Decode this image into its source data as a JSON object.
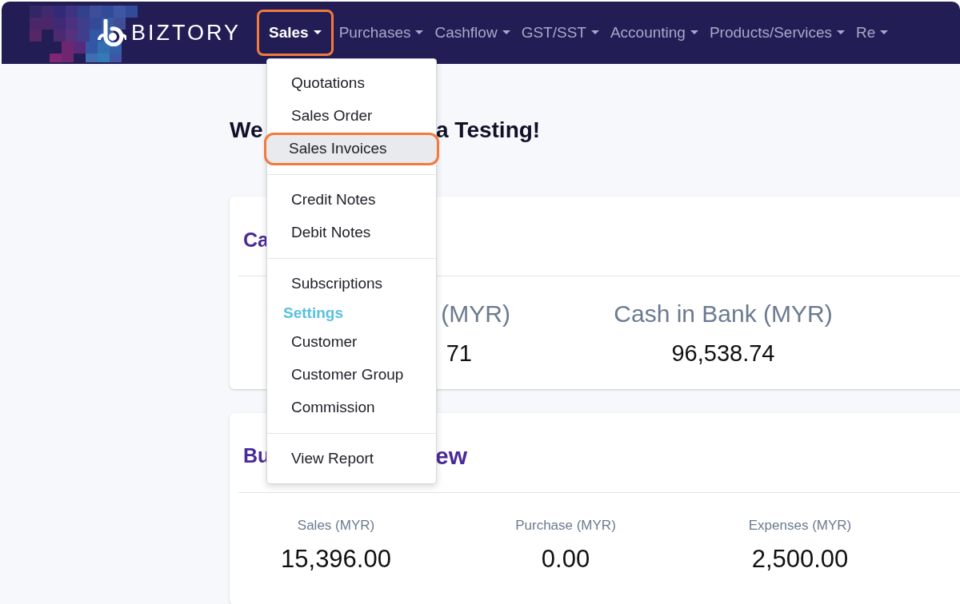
{
  "brand": {
    "name": "BIZTORY"
  },
  "nav": [
    {
      "label": "Sales",
      "selected": true
    },
    {
      "label": "Purchases",
      "selected": false
    },
    {
      "label": "Cashflow",
      "selected": false
    },
    {
      "label": "GST/SST",
      "selected": false
    },
    {
      "label": "Accounting",
      "selected": false
    },
    {
      "label": "Products/Services",
      "selected": false
    },
    {
      "label": "Re",
      "selected": false
    }
  ],
  "heading": {
    "start": "We",
    "end": "a Testing!"
  },
  "cash_card": {
    "title": "Ca",
    "stats": [
      {
        "label": "(MYR)",
        "value": "71"
      },
      {
        "label": "Cash in Bank (MYR)",
        "value": "96,538.74"
      }
    ]
  },
  "business_card": {
    "title_start": "Bu",
    "title_end": "ew",
    "stats": [
      {
        "label": "Sales (MYR)",
        "value": "15,396.00"
      },
      {
        "label": "Purchase (MYR)",
        "value": "0.00"
      },
      {
        "label": "Expenses (MYR)",
        "value": "2,500.00"
      }
    ]
  },
  "menu": [
    {
      "kind": "item",
      "label": "Quotations",
      "highlighted": false
    },
    {
      "kind": "item",
      "label": "Sales Order",
      "highlighted": false
    },
    {
      "kind": "item",
      "label": "Sales Invoices",
      "highlighted": true
    },
    {
      "kind": "divider"
    },
    {
      "kind": "item",
      "label": "Credit Notes",
      "highlighted": false
    },
    {
      "kind": "item",
      "label": "Debit Notes",
      "highlighted": false
    },
    {
      "kind": "divider"
    },
    {
      "kind": "item",
      "label": "Subscriptions",
      "highlighted": false
    },
    {
      "kind": "header",
      "label": "Settings"
    },
    {
      "kind": "item",
      "label": "Customer",
      "highlighted": false
    },
    {
      "kind": "item",
      "label": "Customer Group",
      "highlighted": false
    },
    {
      "kind": "item",
      "label": "Commission",
      "highlighted": false
    },
    {
      "kind": "divider"
    },
    {
      "kind": "item",
      "label": "View Report",
      "highlighted": false
    }
  ]
}
